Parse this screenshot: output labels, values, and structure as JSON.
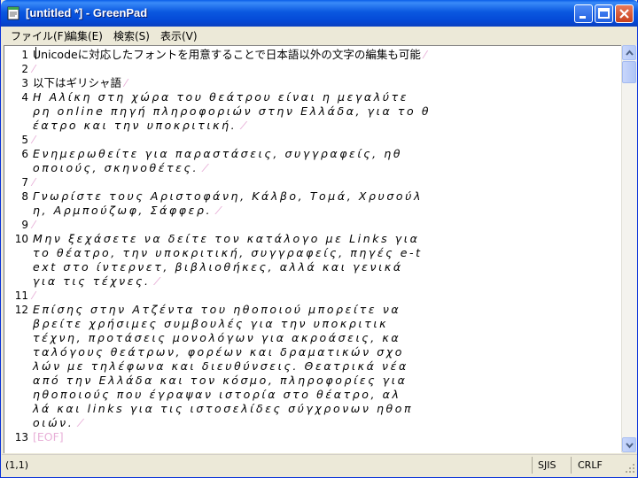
{
  "window": {
    "title": "[untitled *] - GreenPad",
    "colors": {
      "titlebar": "#0a58e0",
      "close": "#c8401c",
      "eol_mark": "#e8b0d8"
    }
  },
  "menu": {
    "items": [
      "ファイル(F)",
      "編集(E)",
      "検索(S)",
      "表示(V)"
    ]
  },
  "editor": {
    "lines": [
      {
        "num": "1",
        "text": "Unicodeに対応したフォントを用意することで日本語以外の文字の編集も可能"
      },
      {
        "num": "2",
        "text": ""
      },
      {
        "num": "3",
        "text": "以下はギリシャ語"
      },
      {
        "num": "4",
        "text": "Η Αλίκη στη χώρα του θεάτρου είναι η μεγαλύτε"
      },
      {
        "num": "",
        "text": "ρη online πηγή πληροφοριών στην Ελλάδα, για το θ"
      },
      {
        "num": "",
        "text": "έατρο και την υποκριτική."
      },
      {
        "num": "5",
        "text": ""
      },
      {
        "num": "6",
        "text": "Ενημερωθείτε για παραστάσεις, συγγραφείς, ηθ"
      },
      {
        "num": "",
        "text": "οποιούς, σκηνοθέτες."
      },
      {
        "num": "7",
        "text": ""
      },
      {
        "num": "8",
        "text": "Γνωρίστε τους Αριστοφάνη, Κάλβο, Τομά, Χρυσούλ"
      },
      {
        "num": "",
        "text": "η, Αρμπούζωφ, Σάφφερ."
      },
      {
        "num": "9",
        "text": ""
      },
      {
        "num": "10",
        "text": "Μην ξεχάσετε να δείτε τον κατάλογο με Links για"
      },
      {
        "num": "",
        "text": " το θέατρο, την υποκριτική, συγγραφείς, πηγές e-t"
      },
      {
        "num": "",
        "text": "ext στο ίντερνετ, βιβλιοθήκες, αλλά και γενικά"
      },
      {
        "num": "",
        "text": " για τις τέχνες."
      },
      {
        "num": "11",
        "text": ""
      },
      {
        "num": "12",
        "text": "Επίσης στην Ατζέντα του ηθοποιού μπορείτε να"
      },
      {
        "num": "",
        "text": " βρείτε χρήσιμες συμβουλές για την υποκριτικ"
      },
      {
        "num": "",
        "text": "τέχνη, προτάσεις μονολόγων για ακροάσεις, κα"
      },
      {
        "num": "",
        "text": "ταλόγους θεάτρων, φορέων και δραματικών σχο"
      },
      {
        "num": "",
        "text": "λών με τηλέφωνα και διευθύνσεις. Θεατρικά νέα"
      },
      {
        "num": "",
        "text": " από την Ελλάδα και τον κόσμο, πληροφορίες για"
      },
      {
        "num": "",
        "text": " ηθοποιούς που έγραψαν ιστορία στο θέατρο, αλ"
      },
      {
        "num": "",
        "text": "λά και links για τις ιστοσελίδες σύγχρονων ηθοπ"
      },
      {
        "num": "",
        "text": "οιών."
      },
      {
        "num": "13",
        "text": ""
      }
    ],
    "eof_label": "[EOF]"
  },
  "status": {
    "position": "(1,1)",
    "encoding": "SJIS",
    "line_ending": "CRLF"
  }
}
